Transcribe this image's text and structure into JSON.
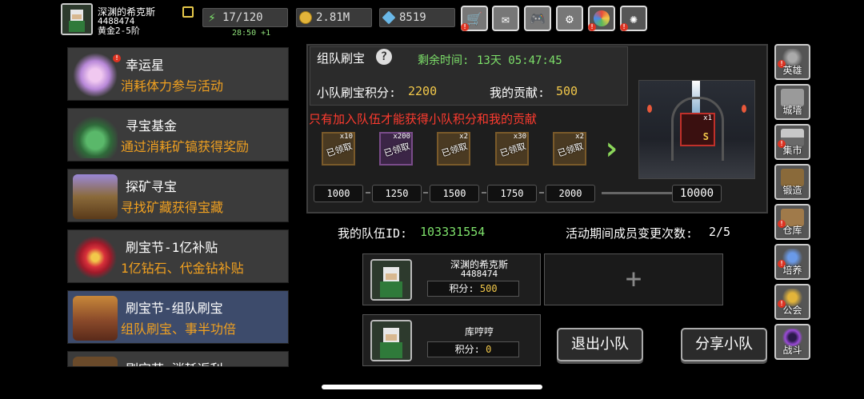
{
  "player": {
    "name": "深渊的希克斯",
    "id": "4488474",
    "level": "黄金2-5阶"
  },
  "resources": {
    "stamina": "17/120",
    "stamina_timer": "28:50 +1",
    "gold": "2.81M",
    "diamonds": "8519"
  },
  "top_buttons": [
    "shop-icon",
    "mail-icon",
    "gamepad-icon",
    "settings-icon",
    "wheel-icon",
    "firework-icon"
  ],
  "events": [
    {
      "title": "幸运星",
      "subtitle": "消耗体力参与活动"
    },
    {
      "title": "寻宝基金",
      "subtitle": "通过消耗矿镐获得奖励"
    },
    {
      "title": "探矿寻宝",
      "subtitle": "寻找矿藏获得宝藏"
    },
    {
      "title": "刷宝节-1亿补贴",
      "subtitle": "1亿钻石、代金钻补贴"
    },
    {
      "title": "刷宝节-组队刷宝",
      "subtitle": "组队刷宝、事半功倍"
    },
    {
      "title": "刷宝节-消耗返利",
      "subtitle": ""
    }
  ],
  "panel": {
    "title": "组队刷宝",
    "time_label": "剩余时间:",
    "time_value": "13天 05:47:45",
    "team_score_label": "小队刷宝积分:",
    "team_score_value": "2200",
    "contribution_label": "我的贡献:",
    "contribution_value": "500",
    "warning": "只有加入队伍才能获得小队积分和我的贡献",
    "claimed_text": "已领取",
    "rewards": [
      {
        "count": "x10",
        "milestone": "1000"
      },
      {
        "count": "x200",
        "milestone": "1250"
      },
      {
        "count": "x2",
        "milestone": "1500"
      },
      {
        "count": "x30",
        "milestone": "1750"
      },
      {
        "count": "x2",
        "milestone": "2000"
      }
    ],
    "final_milestone": "10000",
    "final_reward_count": "x1",
    "final_reward_grade": "S"
  },
  "team": {
    "id_label": "我的队伍ID:",
    "id_value": "103331554",
    "changes_label": "活动期间成员变更次数:",
    "changes_value": "2/5",
    "score_label": "积分:",
    "members": [
      {
        "name": "深渊的希克斯",
        "id": "4488474",
        "score": "500"
      },
      {
        "name": "库哼哼",
        "id": "",
        "score": "0"
      }
    ],
    "add_symbol": "+",
    "leave_button": "退出小队",
    "share_button": "分享小队"
  },
  "nav": [
    {
      "label": "英雄",
      "icon": "hero-icon"
    },
    {
      "label": "城墙",
      "icon": "wall-icon"
    },
    {
      "label": "集市",
      "icon": "market-icon"
    },
    {
      "label": "锻造",
      "icon": "anvil-icon"
    },
    {
      "label": "仓库",
      "icon": "warehouse-icon"
    },
    {
      "label": "培养",
      "icon": "cultivate-icon"
    },
    {
      "label": "公会",
      "icon": "guild-icon"
    },
    {
      "label": "战斗",
      "icon": "battle-icon"
    }
  ]
}
